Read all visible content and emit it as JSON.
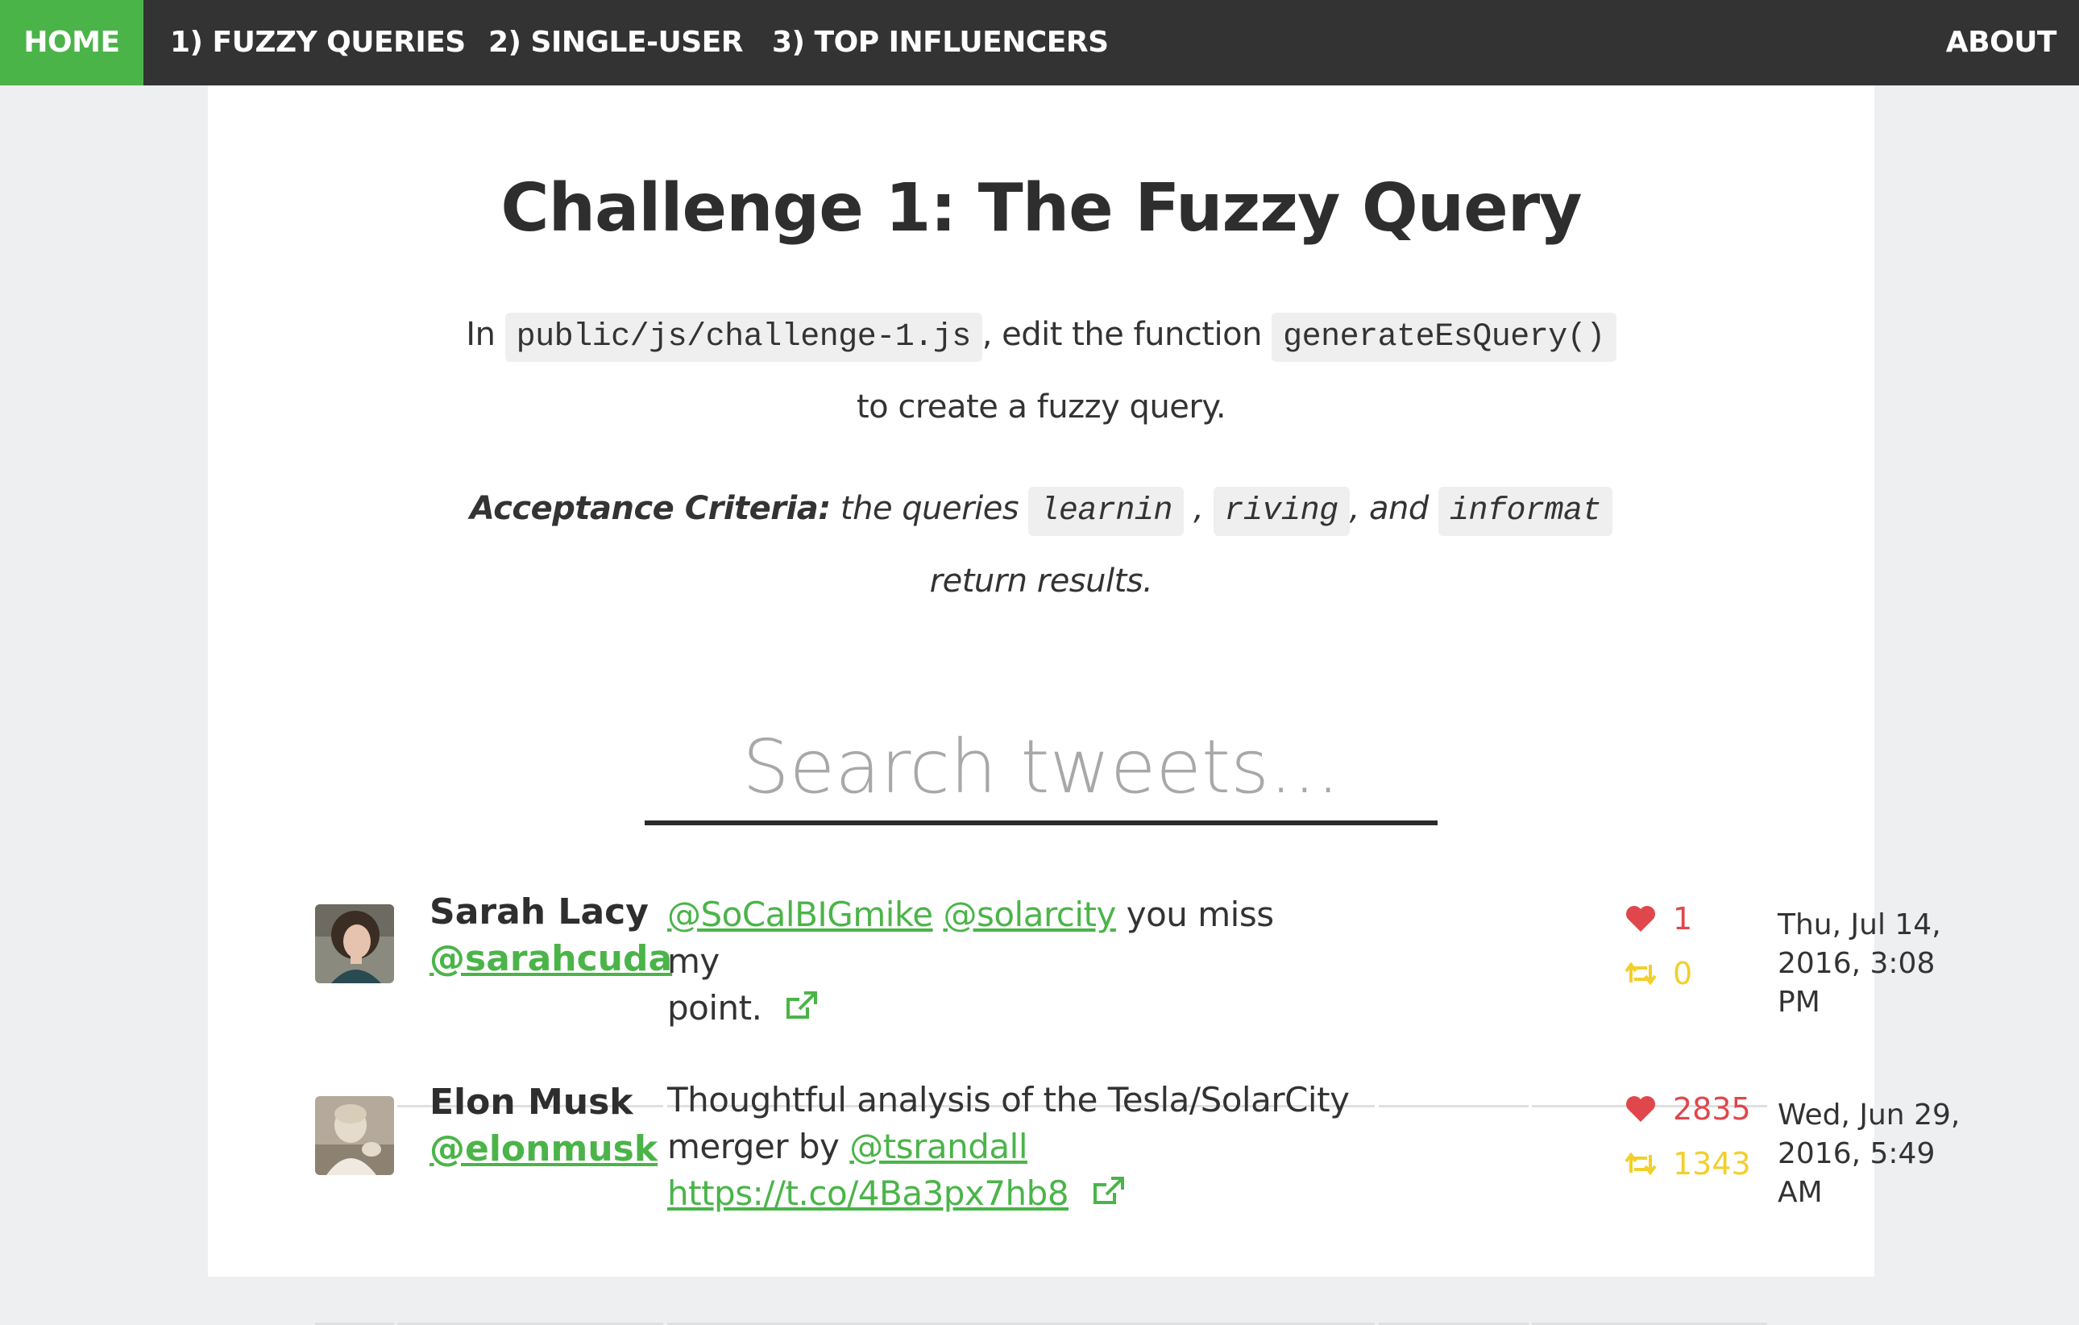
{
  "nav": {
    "home": "HOME",
    "fuzzy": "1) FUZZY QUERIES",
    "single": "2) SINGLE-USER",
    "top": "3) TOP INFLUENCERS",
    "about": "ABOUT"
  },
  "colors": {
    "accent": "#4bb449",
    "nav_bg": "#333333",
    "likes": "#e0474c",
    "retweets": "#f2cf2c"
  },
  "header": {
    "title": "Challenge 1: The Fuzzy Query"
  },
  "instructions": {
    "prefix": "In",
    "file": "public/js/challenge-1.js",
    "middle": ", edit the function",
    "function": "generateEsQuery()",
    "suffix": "to create a fuzzy query."
  },
  "acceptance": {
    "label": "Acceptance Criteria:",
    "text": "the queries",
    "q1": "learnin",
    "sep1": ",",
    "q2": "riving",
    "sep2": ", and",
    "q3": "informat",
    "suffix": "return results."
  },
  "search": {
    "placeholder": "Search tweets..."
  },
  "tweets": [
    {
      "name": "Sarah Lacy",
      "handle": "@sarahcuda",
      "mention1": "@SoCalBIGmike",
      "mention2": "@solarcity",
      "text_a": "you miss my",
      "text_b": "point.",
      "likes": "1",
      "retweets": "0",
      "date_a": "Thu, Jul 14,",
      "date_b": "2016, 3:08 PM",
      "icons": [
        "heart-icon",
        "retweet-icon",
        "external-link-icon"
      ]
    },
    {
      "name": "Elon Musk",
      "handle": "@elonmusk",
      "text_a": "Thoughtful analysis of the Tesla/SolarCity",
      "text_b": "merger by",
      "mention1": "@tsrandall",
      "link": "https://t.co/4Ba3px7hb8",
      "likes": "2835",
      "retweets": "1343",
      "date_a": "Wed, Jun 29,",
      "date_b": "2016, 5:49 AM",
      "icons": [
        "heart-icon",
        "retweet-icon",
        "external-link-icon"
      ]
    }
  ]
}
